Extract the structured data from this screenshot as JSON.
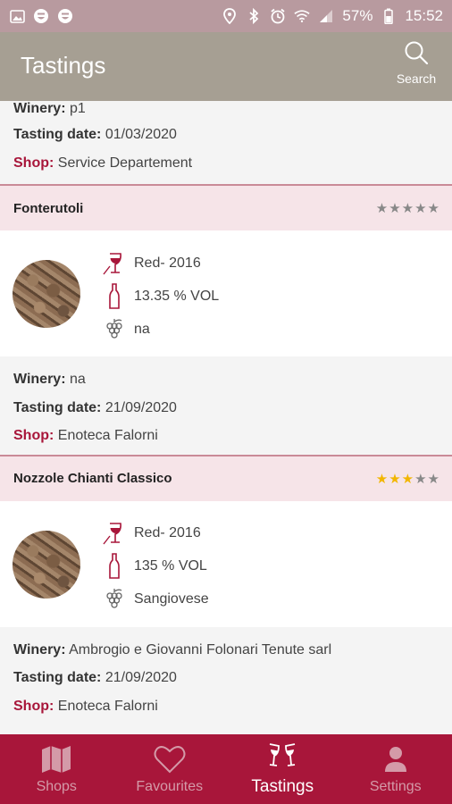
{
  "status_bar": {
    "battery": "57%",
    "time": "15:52",
    "left_icons": [
      "image-icon",
      "smiley-icon",
      "smiley-icon"
    ],
    "right_icons": [
      "location-icon",
      "bluetooth-icon",
      "alarm-icon",
      "wifi-icon",
      "signal-icon",
      "battery-icon"
    ]
  },
  "app_bar": {
    "title": "Tastings",
    "search_label": "Search"
  },
  "colors": {
    "status_bar": "#b89a9f",
    "app_bar": "#a69f93",
    "accent": "#a8163a",
    "card_header": "#f6e4e8",
    "star_on": "#f2b600",
    "star_off": "#888888"
  },
  "partial_top": {
    "winery_label": "Winery:",
    "winery": "p1",
    "tasting_date_label": "Tasting date:",
    "tasting_date": "01/03/2020",
    "shop_label": "Shop:",
    "shop": "Service Departement"
  },
  "tastings": [
    {
      "name": "Fonterutoli",
      "rating": 0,
      "max_rating": 5,
      "color_year": "Red- 2016",
      "alcohol": "13.35 % VOL",
      "grape": "na",
      "winery_label": "Winery:",
      "winery": "na",
      "tasting_date_label": "Tasting date:",
      "tasting_date": "21/09/2020",
      "shop_label": "Shop:",
      "shop": "Enoteca Falorni"
    },
    {
      "name": "Nozzole Chianti Classico",
      "rating": 3,
      "max_rating": 5,
      "color_year": "Red- 2016",
      "alcohol": "135 % VOL",
      "grape": "Sangiovese",
      "winery_label": "Winery:",
      "winery": "Ambrogio e Giovanni Folonari Tenute sarl",
      "tasting_date_label": "Tasting date:",
      "tasting_date": "21/09/2020",
      "shop_label": "Shop:",
      "shop": "Enoteca Falorni"
    }
  ],
  "bottom_nav": [
    {
      "label": "Shops",
      "icon": "map-icon",
      "active": false
    },
    {
      "label": "Favourites",
      "icon": "heart-icon",
      "active": false
    },
    {
      "label": "Tastings",
      "icon": "wine-glasses-icon",
      "active": true
    },
    {
      "label": "Settings",
      "icon": "person-icon",
      "active": false
    }
  ]
}
